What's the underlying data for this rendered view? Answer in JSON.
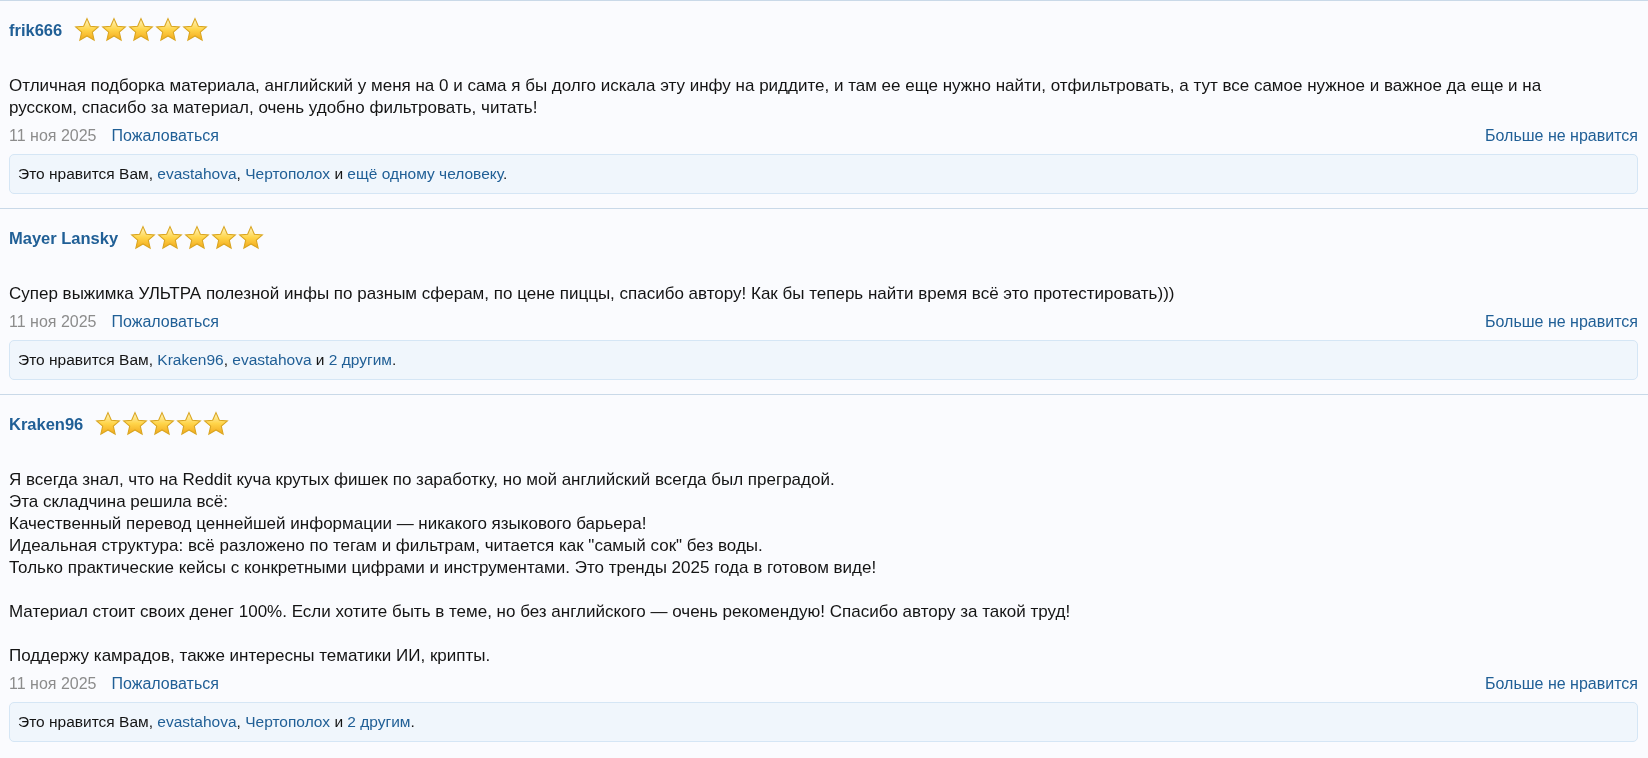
{
  "reviews": [
    {
      "author": "frik666",
      "stars": 5,
      "body": "Отличная подборка материала, английский у меня на 0 и сама я бы долго искала эту инфу на риддите, и там ее еще нужно найти, отфильтровать, а тут все самое нужное и важное да еще и на русском, спасибо за материал, очень удобно фильтровать, читать!",
      "date": "11 ноя 2025",
      "report": "Пожаловаться",
      "unlike": "Больше не нравится",
      "likes": [
        {
          "kind": "text",
          "text": "Это нравится Вам, "
        },
        {
          "kind": "link",
          "text": "evastahova"
        },
        {
          "kind": "text",
          "text": ", "
        },
        {
          "kind": "link",
          "text": "Чертополох"
        },
        {
          "kind": "text",
          "text": " и "
        },
        {
          "kind": "link",
          "text": "ещё одному человеку"
        },
        {
          "kind": "text",
          "text": "."
        }
      ]
    },
    {
      "author": "Mayer Lansky",
      "stars": 5,
      "body": "Супер выжимка УЛЬТРА полезной инфы по разным сферам, по цене пиццы, спасибо автору! Как бы теперь найти время всё это протестировать)))",
      "date": "11 ноя 2025",
      "report": "Пожаловаться",
      "unlike": "Больше не нравится",
      "likes": [
        {
          "kind": "text",
          "text": "Это нравится Вам, "
        },
        {
          "kind": "link",
          "text": "Kraken96"
        },
        {
          "kind": "text",
          "text": ", "
        },
        {
          "kind": "link",
          "text": "evastahova"
        },
        {
          "kind": "text",
          "text": " и "
        },
        {
          "kind": "link",
          "text": "2 другим"
        },
        {
          "kind": "text",
          "text": "."
        }
      ]
    },
    {
      "author": "Kraken96",
      "stars": 5,
      "body": "Я всегда знал, что на Reddit куча крутых фишек по заработку, но мой английский всегда был преградой.\nЭта складчина решила всё:\nКачественный перевод ценнейшей информации — никакого языкового барьера!\nИдеальная структура: всё разложено по тегам и фильтрам, читается как \"самый сок\" без воды.\nТолько практические кейсы с конкретными цифрами и инструментами. Это тренды 2025 года в готовом виде!\n\nМатериал стоит своих денег 100%. Если хотите быть в теме, но без английского — очень рекомендую! Спасибо автору за такой труд!\n\nПоддержу камрадов, также интересны тематики ИИ, крипты.",
      "date": "11 ноя 2025",
      "report": "Пожаловаться",
      "unlike": "Больше не нравится",
      "likes": [
        {
          "kind": "text",
          "text": "Это нравится Вам, "
        },
        {
          "kind": "link",
          "text": "evastahova"
        },
        {
          "kind": "text",
          "text": ", "
        },
        {
          "kind": "link",
          "text": "Чертополох"
        },
        {
          "kind": "text",
          "text": " и "
        },
        {
          "kind": "link",
          "text": "2 другим"
        },
        {
          "kind": "text",
          "text": "."
        }
      ]
    }
  ]
}
